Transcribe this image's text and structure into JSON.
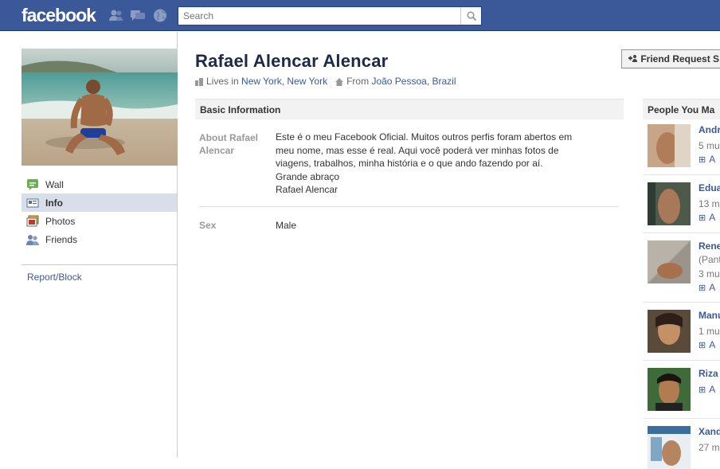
{
  "topbar": {
    "logo": "facebook",
    "search_placeholder": "Search",
    "jewels": [
      "friend-requests-icon",
      "messages-icon",
      "notifications-globe-icon"
    ]
  },
  "profile": {
    "name": "Rafael Alencar Alencar",
    "lives_prefix": "Lives in",
    "lives_city": "New York, New York",
    "from_prefix": "From",
    "from_city": "João Pessoa, Brazil",
    "friend_request_button": "Friend Request S"
  },
  "sidebar": {
    "items": [
      {
        "label": "Wall",
        "icon": "wall-icon",
        "active": false
      },
      {
        "label": "Info",
        "icon": "info-icon",
        "active": true
      },
      {
        "label": "Photos",
        "icon": "photos-icon",
        "active": false
      },
      {
        "label": "Friends",
        "icon": "friends-icon",
        "active": false
      }
    ],
    "report_link": "Report/Block"
  },
  "basic_info": {
    "header": "Basic Information",
    "about_label_line1": "About Rafael",
    "about_label_line2": "Alencar",
    "about_lines": [
      "Este é o meu Facebook Oficial. Muitos outros perfis foram abertos em",
      "meu nome, mas esse é real. Aqui você poderá ver minhas fotos de",
      "viagens, trabalhos, minha história e o que ando fazendo por aí.",
      "Grande abraço",
      "Rafael Alencar"
    ],
    "sex_label": "Sex",
    "sex_value": "Male"
  },
  "pymk": {
    "header": "People You Ma",
    "people": [
      {
        "name": "Andr",
        "line1": "5 mu",
        "line2": "",
        "add": "A"
      },
      {
        "name": "Edua",
        "line1": "13 m",
        "line2": "",
        "add": "A"
      },
      {
        "name": "Rene",
        "line1": "(Pant",
        "line2": "3 mu",
        "add": "A"
      },
      {
        "name": "Manu",
        "line1": "1 mu",
        "line2": "",
        "add": "A"
      },
      {
        "name": "Riza",
        "line1": "",
        "line2": "",
        "add": "A"
      },
      {
        "name": "Xand",
        "line1": "27 m",
        "line2": "",
        "add": ""
      }
    ]
  },
  "colors": {
    "brand": "#3b5998",
    "link": "#3b5998",
    "active_nav": "#d8dfea"
  }
}
